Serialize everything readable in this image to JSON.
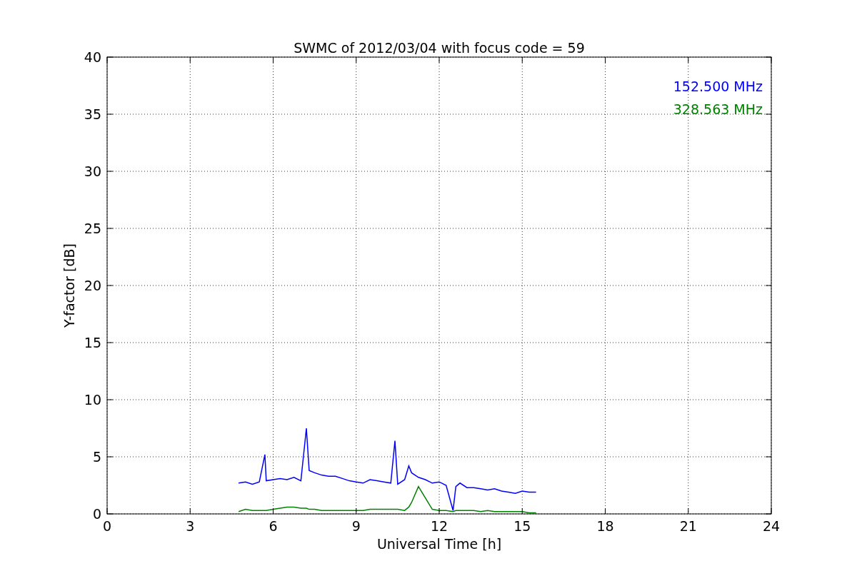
{
  "chart_data": {
    "type": "line",
    "title": "SWMC of 2012/03/04 with focus code = 59",
    "xlabel": "Universal Time [h]",
    "ylabel": "Y-factor [dB]",
    "x": [
      4.75,
      5,
      5.25,
      5.5,
      5.7,
      5.75,
      6,
      6.25,
      6.5,
      6.75,
      7,
      7.2,
      7.3,
      7.5,
      7.75,
      8,
      8.25,
      8.5,
      8.75,
      9,
      9.25,
      9.5,
      9.75,
      10,
      10.25,
      10.4,
      10.5,
      10.75,
      10.9,
      11,
      11.25,
      11.5,
      11.75,
      12,
      12.25,
      12.5,
      12.6,
      12.75,
      13,
      13.25,
      13.5,
      13.75,
      14,
      14.25,
      14.5,
      14.75,
      15,
      15.25,
      15.5
    ],
    "series": [
      {
        "name": "152.500 MHz",
        "color": "#0000ff",
        "values": [
          2.7,
          2.8,
          2.6,
          2.8,
          5.2,
          2.9,
          3.0,
          3.1,
          3.0,
          3.2,
          2.9,
          7.5,
          3.8,
          3.6,
          3.4,
          3.3,
          3.3,
          3.1,
          2.9,
          2.8,
          2.7,
          3.0,
          2.9,
          2.8,
          2.7,
          6.4,
          2.6,
          3.0,
          4.2,
          3.6,
          3.2,
          3.0,
          2.7,
          2.8,
          2.5,
          0.3,
          2.4,
          2.7,
          2.3,
          2.3,
          2.2,
          2.1,
          2.2,
          2.0,
          1.9,
          1.8,
          2.0,
          1.9,
          1.9
        ]
      },
      {
        "name": "328.563 MHz",
        "color": "#008000",
        "values": [
          0.2,
          0.4,
          0.3,
          0.3,
          0.3,
          0.3,
          0.4,
          0.5,
          0.6,
          0.6,
          0.5,
          0.5,
          0.4,
          0.4,
          0.3,
          0.3,
          0.3,
          0.3,
          0.3,
          0.3,
          0.3,
          0.4,
          0.4,
          0.4,
          0.4,
          0.4,
          0.4,
          0.3,
          0.6,
          1.0,
          2.4,
          1.4,
          0.4,
          0.3,
          0.3,
          0.2,
          0.3,
          0.3,
          0.3,
          0.3,
          0.2,
          0.3,
          0.2,
          0.2,
          0.2,
          0.2,
          0.2,
          0.1,
          0.1
        ]
      }
    ],
    "xlim": [
      0,
      24
    ],
    "ylim": [
      0,
      40
    ],
    "xticks": [
      0,
      3,
      6,
      9,
      12,
      15,
      18,
      21,
      24
    ],
    "yticks": [
      0,
      5,
      10,
      15,
      20,
      25,
      30,
      35,
      40
    ],
    "grid": true
  }
}
